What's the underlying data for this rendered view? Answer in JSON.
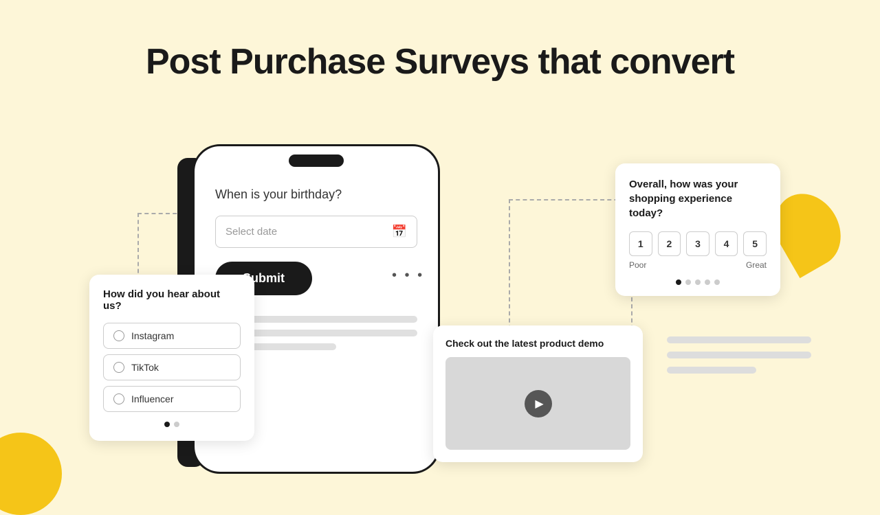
{
  "hero": {
    "title": "Post Purchase Surveys that convert"
  },
  "phone": {
    "question": "When is your birthday?",
    "input_placeholder": "Select date",
    "submit_label": "Submit"
  },
  "survey_left": {
    "question": "How did you hear about us?",
    "options": [
      "Instagram",
      "TikTok",
      "Influencer"
    ],
    "dots": [
      true,
      false
    ]
  },
  "survey_right": {
    "question": "Overall, how was your shopping experience today?",
    "ratings": [
      "1",
      "2",
      "3",
      "4",
      "5"
    ],
    "label_poor": "Poor",
    "label_great": "Great",
    "dots": [
      true,
      false,
      false,
      false,
      false
    ]
  },
  "video_card": {
    "title": "Check out the latest product demo",
    "play_label": "▶"
  },
  "dots_menu": "• • •"
}
